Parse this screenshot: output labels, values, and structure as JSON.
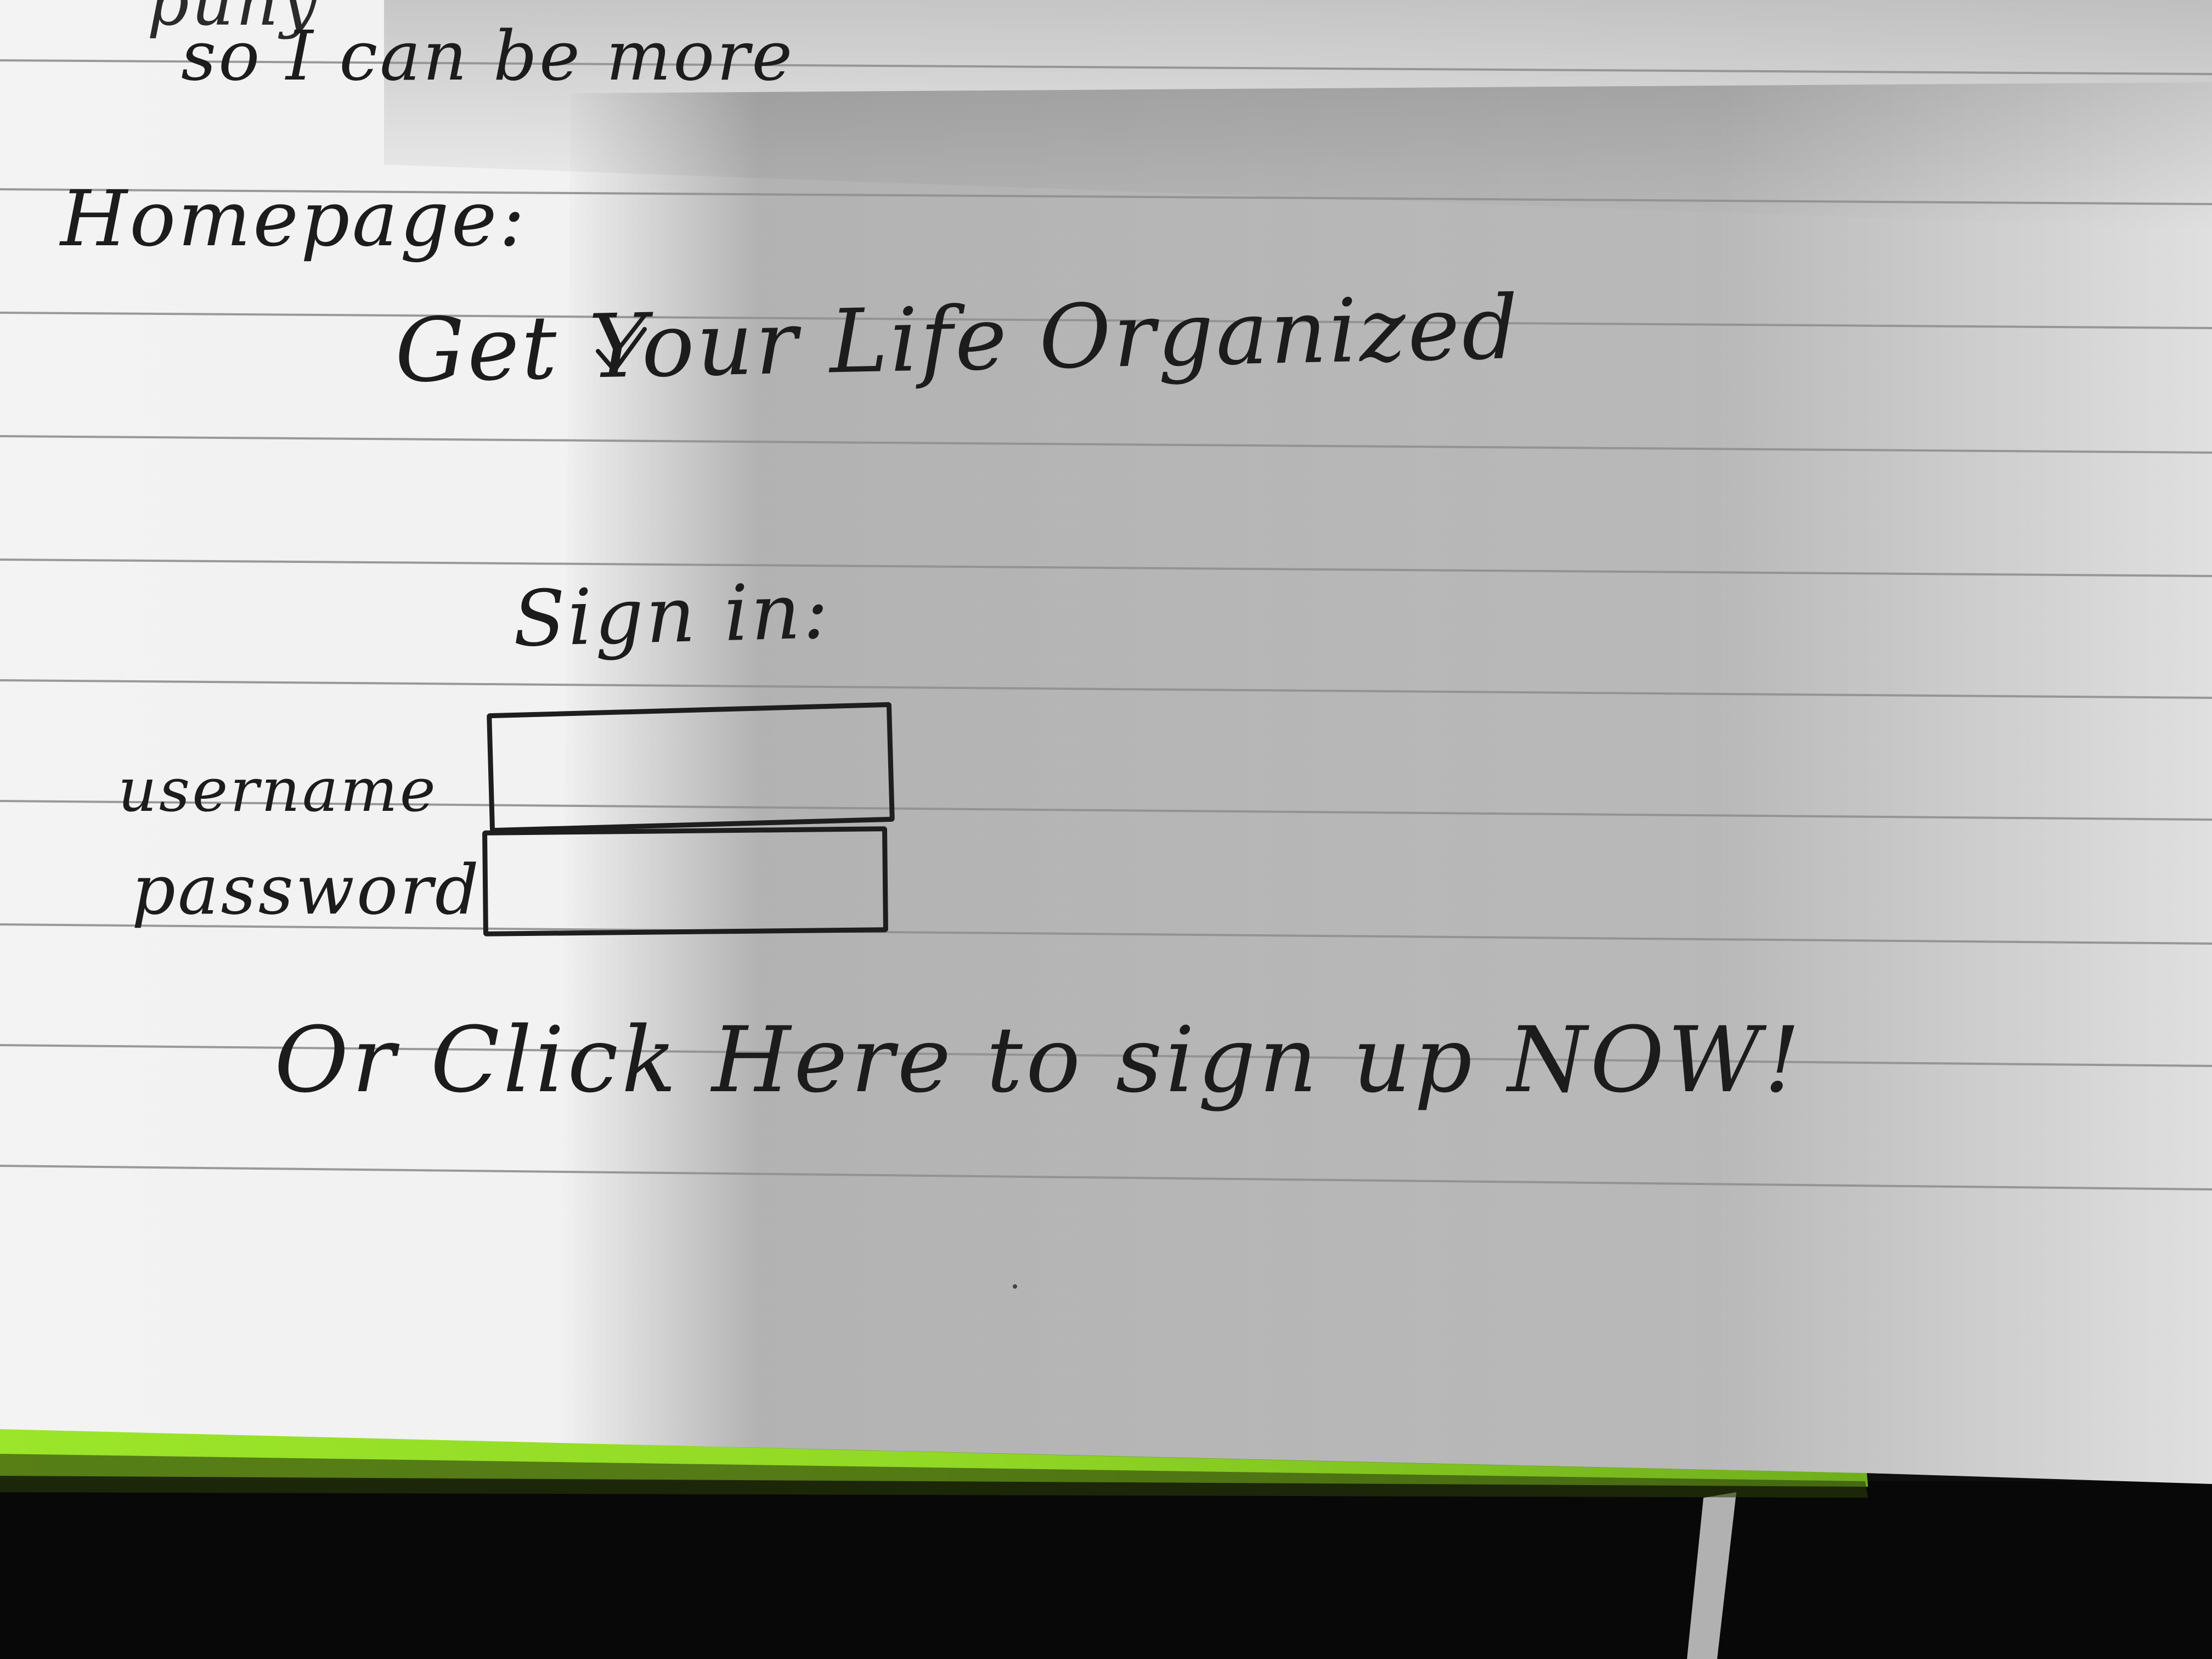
{
  "notebook_page": {
    "top_line_1": "puny",
    "top_line_2": "so I can be more",
    "homepage_label": "Homepage:",
    "tagline": "Get Your Life Organized",
    "sign_in_label": "Sign in:",
    "username_label": "username",
    "password_label": "password",
    "signup_prompt": "Or Click Here to sign up NOW!"
  },
  "colors": {
    "paper": "#f1f1f1",
    "rule_line": "#8f8f8f",
    "ink": "#1c1c1c",
    "cover_green": "#9ae02a",
    "background": "#0d0d0d"
  }
}
